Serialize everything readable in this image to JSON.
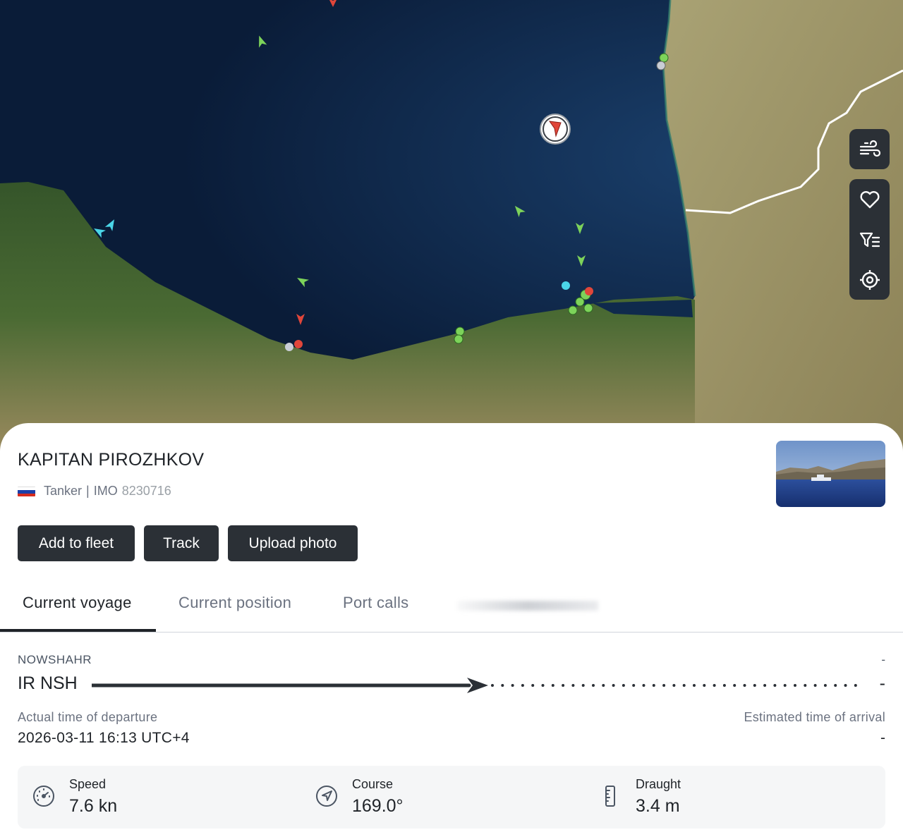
{
  "map": {
    "selected_vessel_icon": "red-arrow-selected-marker",
    "controls": [
      {
        "name": "weather-layer",
        "icon": "wind-icon"
      },
      {
        "name": "favorites",
        "icon": "heart-icon"
      },
      {
        "name": "filters",
        "icon": "filter-list-icon"
      },
      {
        "name": "locate",
        "icon": "crosshair-icon"
      }
    ]
  },
  "vessel": {
    "name": "KAPITAN PIROZHKOV",
    "flag_icon": "russia-flag-icon",
    "type": "Tanker",
    "separator": "|",
    "imo_label": "IMO",
    "imo": "8230716"
  },
  "actions": {
    "add_to_fleet": "Add to fleet",
    "track": "Track",
    "upload_photo": "Upload photo"
  },
  "tabs": [
    {
      "label": "Current voyage",
      "active": true
    },
    {
      "label": "Current position",
      "active": false
    },
    {
      "label": "Port calls",
      "active": false
    }
  ],
  "voyage": {
    "departure_port": "NOWSHAHR",
    "departure_locode": "IR NSH",
    "arrival_port": "-",
    "arrival_locode": "-",
    "atd_label": "Actual time of departure",
    "atd_value": "2026-03-11 16:13 UTC+4",
    "eta_label": "Estimated time of arrival",
    "eta_value": "-"
  },
  "stats": {
    "speed_label": "Speed",
    "speed_value": "7.6 kn",
    "course_label": "Course",
    "course_value": "169.0°",
    "draught_label": "Draught",
    "draught_value": "3.4 m"
  },
  "colors": {
    "dark_button": "#2b3036",
    "sea": "#0b1f3d",
    "land": "#8f8a5a",
    "forest": "#3e5b2a"
  }
}
